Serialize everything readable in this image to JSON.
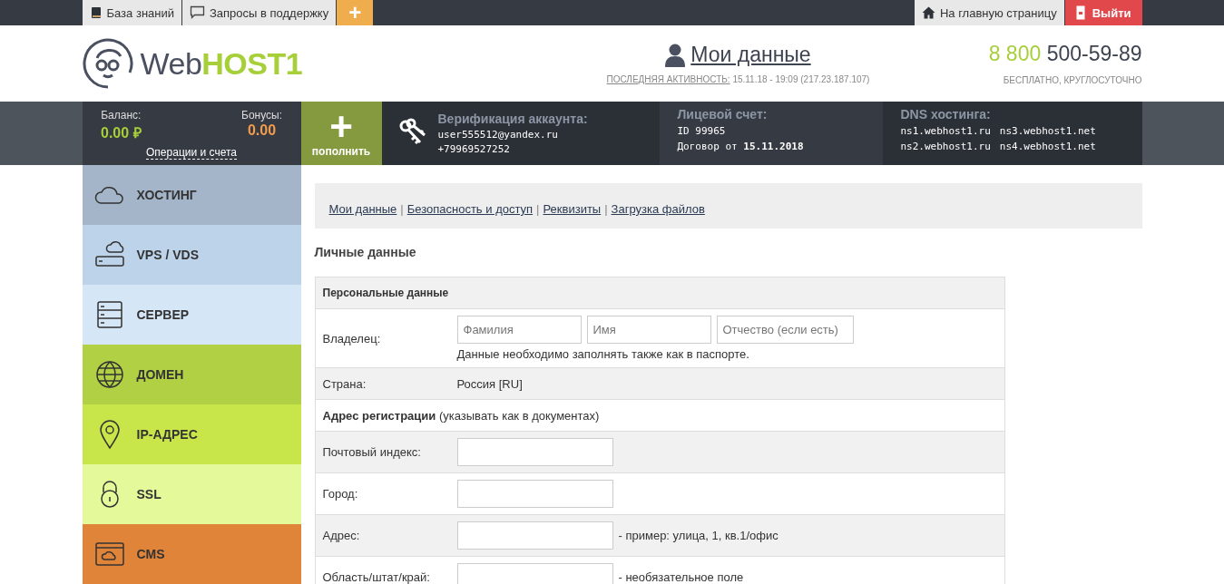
{
  "topbar": {
    "left": [
      {
        "kind": "book",
        "label": "База знаний"
      },
      {
        "kind": "chat",
        "label": "Запросы в поддержку"
      }
    ],
    "add_button": "+",
    "home": "На главную страницу",
    "logout": "Выйти"
  },
  "header": {
    "logo": {
      "part1": "Web",
      "part2": "HOST1"
    },
    "title": "Мои данные",
    "activity_label": "ПОСЛЕДНЯЯ АКТИВНОСТЬ:",
    "activity_value": "15.11.18 - 19:09 (217.23.187.107)",
    "phone_code": "8 800",
    "phone_number": "500-59-89",
    "phone_note": "БЕСПЛАТНО, КРУГЛОСУТОЧНО"
  },
  "infobar": {
    "balance_label": "Баланс:",
    "balance_value": "0.00 ₽",
    "bonus_label": "Бонусы:",
    "bonus_value": "0.00",
    "operations_link": "Операции и счета",
    "topup_icon": "+",
    "topup_label": "пополнить",
    "verification_title": "Верификация аккаунта:",
    "email": "user555512@yandex.ru",
    "phone": "+79969527252",
    "account_title": "Лицевой счет:",
    "account_id": "ID 99965",
    "contract_prefix": "Договор от",
    "contract_date": "15.11.2018",
    "dns_title": "DNS хостинга:",
    "dns": [
      "ns1.webhost1.ru",
      "ns3.webhost1.net",
      "ns2.webhost1.ru",
      "ns4.webhost1.net"
    ]
  },
  "sidebar": {
    "items": [
      {
        "kind": "cloud",
        "label": "ХОСТИНГ",
        "color": "#a4b5c9"
      },
      {
        "kind": "vps",
        "label": "VPS / VDS",
        "color": "#bcd3ea"
      },
      {
        "kind": "server",
        "label": "СЕРВЕР",
        "color": "#d5e6f7"
      },
      {
        "kind": "globe",
        "label": "ДОМЕН",
        "color": "#b2d044"
      },
      {
        "kind": "pin",
        "label": "IP-АДРЕС",
        "color": "#c8e64a"
      },
      {
        "kind": "lock",
        "label": "SSL",
        "color": "#e3f99a"
      },
      {
        "kind": "cms",
        "label": "CMS",
        "color": "#e0843a"
      }
    ]
  },
  "subnav_separator": "|",
  "subnav": [
    "Мои данные",
    "Безопасность и доступ",
    "Реквизиты",
    "Загрузка файлов"
  ],
  "section_title": "Личные данные",
  "form": {
    "heading": "Персональные данные",
    "owner_label": "Владелец:",
    "owner_fields": [
      {
        "placeholder": "Фамилия"
      },
      {
        "placeholder": "Имя"
      },
      {
        "placeholder": "Отчество (если есть)"
      }
    ],
    "owner_note": "Данные необходимо заполнять также как в паспорте.",
    "country_label": "Страна:",
    "country_value": "Россия [RU]",
    "address_heading": "**Адрес регистрации** (указывать как в документах)",
    "rows": [
      {
        "label": "Почтовый индекс:"
      },
      {
        "label": "Город:"
      },
      {
        "label": "Адрес:",
        "note": "- пример: улица, 1, кв.1/офис"
      },
      {
        "label": "Область/штат/край:",
        "note": "- необязательное поле"
      }
    ]
  }
}
